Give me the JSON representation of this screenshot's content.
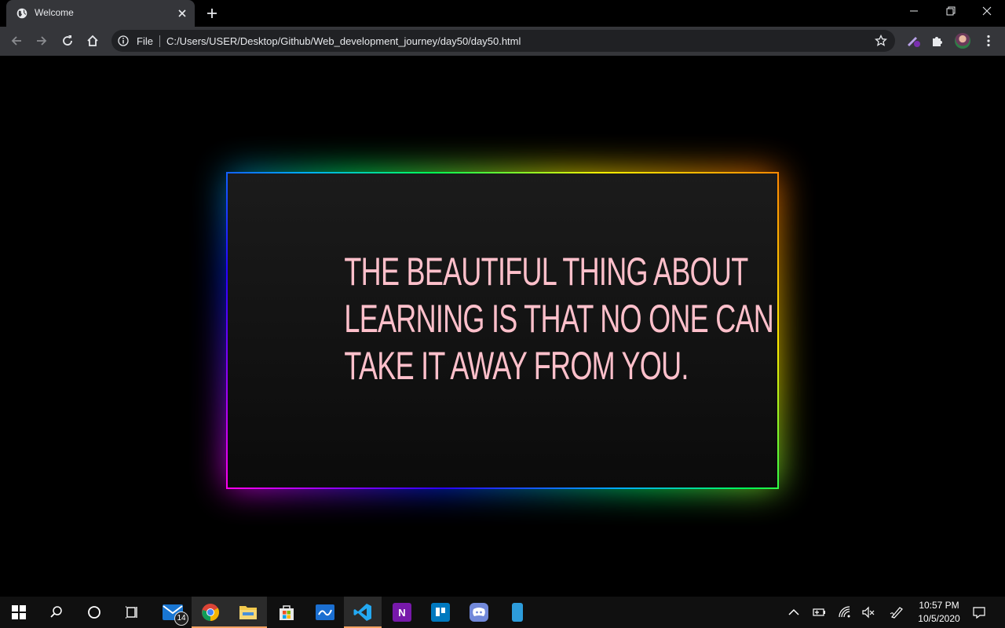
{
  "browser": {
    "tab_title": "Welcome",
    "address_scheme": "File",
    "address_url": "C:/Users/USER/Desktop/Github/Web_development_journey/day50/day50.html"
  },
  "page": {
    "quote_lines": [
      "THE BEAUTIFUL THING ABOUT",
      "LEARNING IS THAT NO ONE CAN",
      "TAKE IT AWAY FROM YOU."
    ],
    "quote_color": "#ffc0cb",
    "glow_colors": [
      "#ff00ee",
      "#2a00ff",
      "#00aaff",
      "#00ff55",
      "#ffee00",
      "#ff8800"
    ]
  },
  "taskbar": {
    "mail_badge": "14",
    "time": "10:57 PM",
    "date": "10/5/2020",
    "apps": [
      "mail-icon",
      "chrome-icon",
      "file-explorer-icon",
      "store-icon",
      "whiteboard-icon",
      "vscode-icon",
      "onenote-icon",
      "trello-icon",
      "discord-icon",
      "phone-app-icon"
    ]
  }
}
